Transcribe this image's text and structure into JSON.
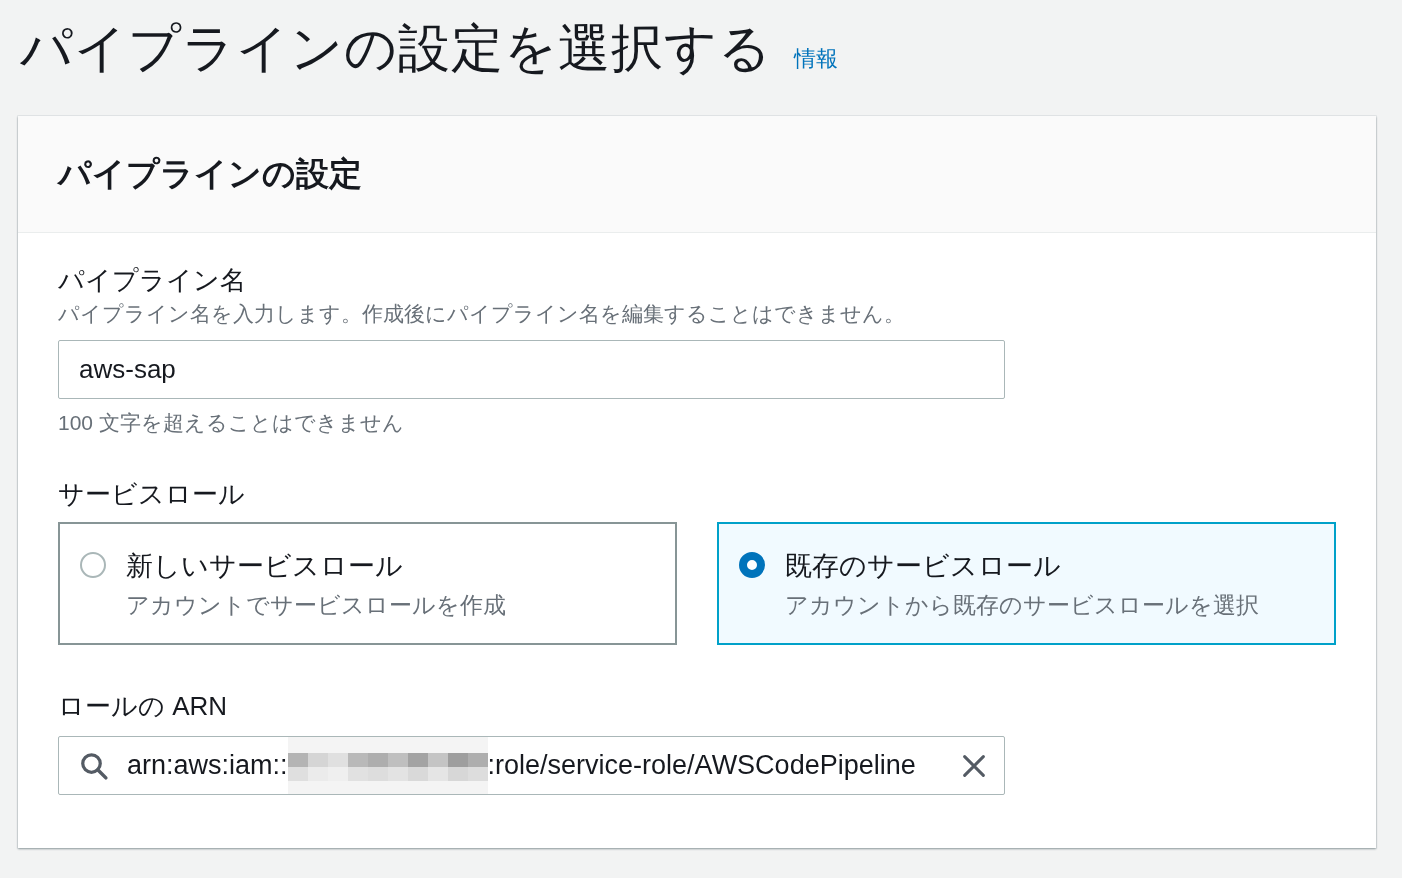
{
  "page": {
    "title": "パイプラインの設定を選択する",
    "info_link": "情報"
  },
  "panel": {
    "title": "パイプラインの設定"
  },
  "name_field": {
    "label": "パイプライン名",
    "description": "パイプライン名を入力します。作成後にパイプライン名を編集することはできません。",
    "value": "aws-sap",
    "constraint": "100 文字を超えることはできません"
  },
  "service_role": {
    "label": "サービスロール",
    "options": [
      {
        "title": "新しいサービスロール",
        "description": "アカウントでサービスロールを作成",
        "selected": false
      },
      {
        "title": "既存のサービスロール",
        "description": "アカウントから既存のサービスロールを選択",
        "selected": true
      }
    ]
  },
  "role_arn": {
    "label": "ロールの ARN",
    "value_prefix": "arn:aws:iam::",
    "redacted": true,
    "value_suffix": ":role/service-role/AWSCodePipeline"
  }
}
